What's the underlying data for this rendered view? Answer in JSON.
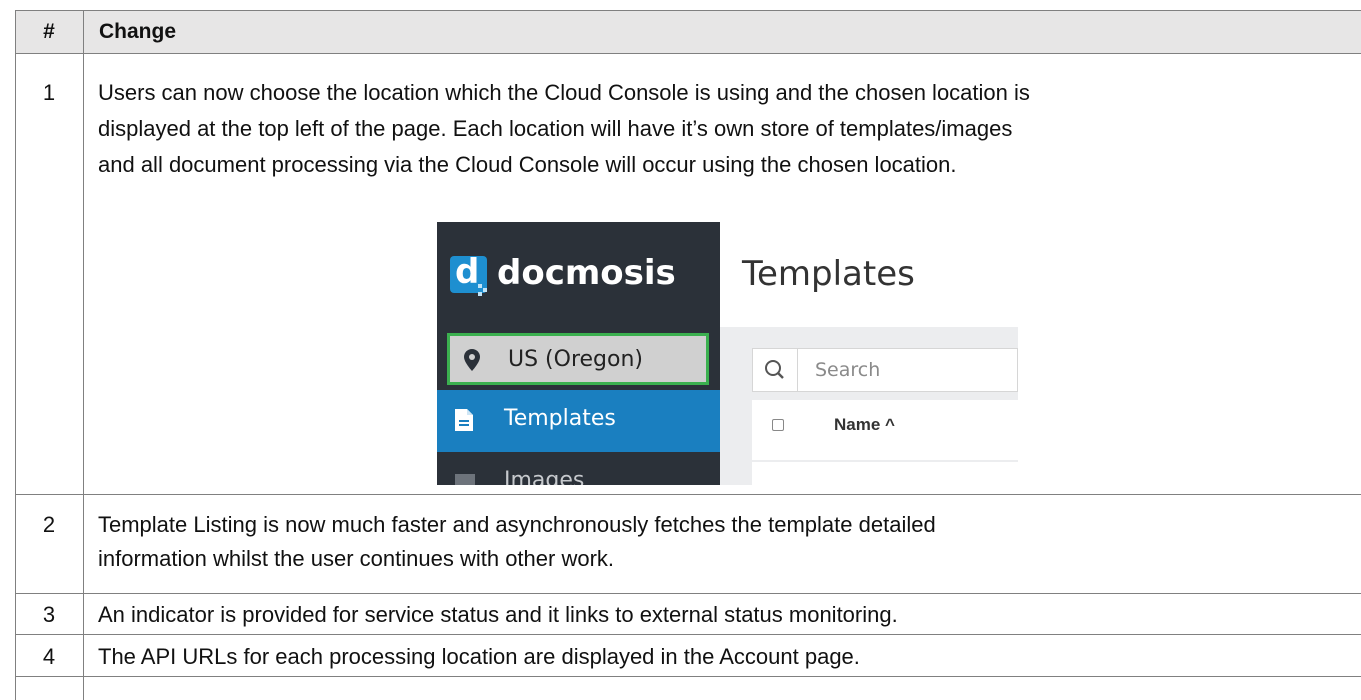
{
  "table": {
    "headers": {
      "number": "#",
      "change": "Change"
    },
    "rows": [
      {
        "number": "1",
        "lines": [
          "Users can now choose the location which the Cloud Console is using and the chosen location is",
          "displayed at the top left of the page.  Each location will have it’s own store of templates/images",
          "and all document processing via the Cloud Console will occur using the chosen location."
        ]
      },
      {
        "number": "2",
        "lines": [
          "Template Listing is now much faster and asynchronously fetches the template detailed",
          "information whilst the user continues with other work."
        ]
      },
      {
        "number": "3",
        "lines": [
          "An indicator is provided for service status and it links to external status monitoring."
        ]
      },
      {
        "number": "4",
        "lines": [
          "The API URLs for each processing location are displayed in the Account page."
        ]
      }
    ]
  },
  "screenshot": {
    "logo_text": "docmosis",
    "logo_letter": "d",
    "location_label": "US (Oregon)",
    "nav_active_label": "Templates",
    "nav_next_label": "Images",
    "page_title": "Templates",
    "search_placeholder": "Search",
    "column_name": "Name ^",
    "icons": [
      "map-marker-icon",
      "document-icon",
      "search-icon"
    ],
    "colors": {
      "sidebar": "#2b3139",
      "active_nav": "#1a7fc0",
      "highlight_border": "#3bb04f",
      "logo": "#1e8fd0"
    }
  }
}
